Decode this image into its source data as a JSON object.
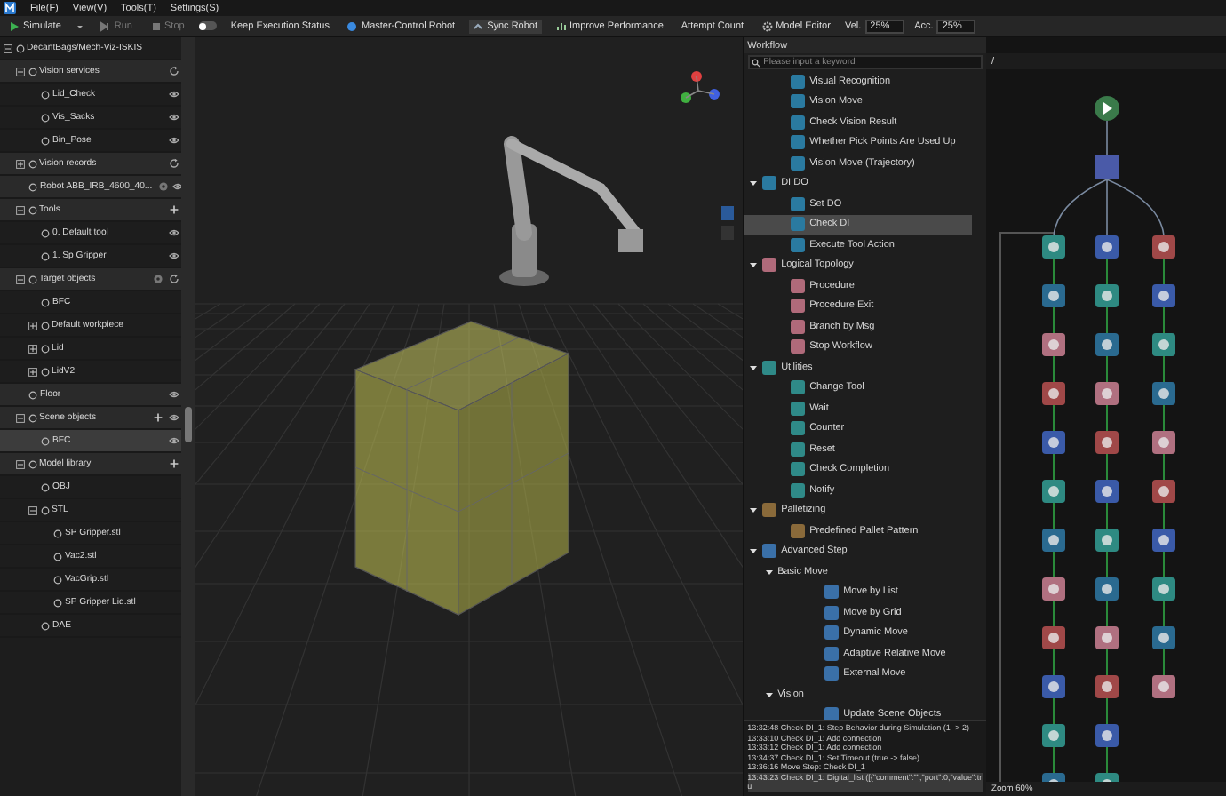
{
  "menu": [
    "File(F)",
    "View(V)",
    "Tools(T)",
    "Settings(S)"
  ],
  "toolbar": [
    {
      "kind": "button",
      "label": "Simulate",
      "disabled": false,
      "active": false
    },
    {
      "kind": "caret"
    },
    {
      "kind": "button",
      "label": "Run",
      "disabled": true,
      "active": false
    },
    {
      "kind": "button",
      "label": "Stop",
      "disabled": true,
      "active": false
    },
    {
      "kind": "toggle",
      "label": "Keep Execution Status",
      "on": false
    },
    {
      "kind": "button",
      "label": "Master-Control Robot",
      "disabled": false,
      "active": false
    },
    {
      "kind": "button",
      "label": "Sync Robot",
      "disabled": false,
      "active": true
    },
    {
      "kind": "button",
      "label": "Improve Performance",
      "disabled": false,
      "active": false
    },
    {
      "kind": "button",
      "label": "Attempt Count",
      "disabled": false,
      "active": false
    },
    {
      "kind": "button",
      "label": "Model Editor",
      "disabled": false,
      "active": false
    },
    {
      "kind": "field",
      "label": "Vel.",
      "value": "25%"
    },
    {
      "kind": "field",
      "label": "Acc.",
      "value": "25%"
    }
  ],
  "tree": {
    "items": [
      {
        "label": "DecantBags/Mech-Viz-ISKIS",
        "expanded": true,
        "selected": false,
        "children": [
          {
            "kind": "refreshable",
            "label": "Vision services",
            "expanded": true,
            "selected": false,
            "children": [
              {
                "label": "Lid_Check",
                "selected": false,
                "visible": true
              },
              {
                "label": "Vis_Sacks",
                "selected": false,
                "visible": true
              },
              {
                "label": "Bin_Pose",
                "selected": false,
                "visible": true
              }
            ]
          },
          {
            "kind": "refreshable",
            "label": "Vision records",
            "expanded": false,
            "selected": false
          },
          {
            "kind": "configurable",
            "label": "Robot ABB_IRB_4600_40...",
            "selected": false,
            "visible": true
          },
          {
            "kind": "addable",
            "label": "Tools",
            "expanded": true,
            "selected": false,
            "children": [
              {
                "label": "0. Default tool",
                "selected": false,
                "visible": true
              },
              {
                "label": "1. Sp Gripper",
                "selected": false,
                "visible": true
              }
            ]
          },
          {
            "kind": "configurable-refreshable",
            "label": "Target objects",
            "expanded": true,
            "selected": false,
            "children": [
              {
                "label": "BFC",
                "selected": false
              },
              {
                "label": "Default workpiece",
                "expanded": false,
                "selected": false
              },
              {
                "label": "Lid",
                "expanded": false,
                "selected": false
              },
              {
                "label": "LidV2",
                "expanded": false,
                "selected": false
              }
            ]
          },
          {
            "label": "Floor",
            "selected": false,
            "visible": true
          },
          {
            "kind": "addable",
            "label": "Scene objects",
            "expanded": true,
            "selected": false,
            "visible": true,
            "children": [
              {
                "label": "BFC",
                "selected": true,
                "visible": true
              }
            ]
          },
          {
            "kind": "addable",
            "label": "Model library",
            "expanded": true,
            "selected": false,
            "children": [
              {
                "label": "OBJ",
                "selected": false
              },
              {
                "label": "STL",
                "expanded": true,
                "selected": false,
                "children": [
                  {
                    "label": "SP Gripper.stl",
                    "selected": false
                  },
                  {
                    "label": "Vac2.stl",
                    "selected": false
                  },
                  {
                    "label": "VacGrip.stl",
                    "selected": false
                  },
                  {
                    "label": "SP Gripper Lid.stl",
                    "selected": false
                  }
                ]
              },
              {
                "label": "DAE",
                "selected": false
              }
            ]
          }
        ]
      }
    ]
  },
  "workflow": {
    "title": "Workflow",
    "search": {
      "placeholder": "Please input a keyword"
    },
    "items": [
      {
        "kind": "step",
        "label": "Visual Recognition",
        "selected": false
      },
      {
        "kind": "step",
        "label": "Vision Move",
        "selected": false
      },
      {
        "kind": "step",
        "label": "Check Vision Result",
        "selected": false
      },
      {
        "kind": "step",
        "label": "Whether Pick Points Are Used Up",
        "selected": false
      },
      {
        "kind": "step",
        "label": "Vision Move (Trajectory)",
        "selected": false
      },
      {
        "kind": "category",
        "label": "DI DO",
        "expanded": true,
        "selected": false,
        "children": [
          {
            "kind": "step",
            "label": "Set DO",
            "selected": false
          },
          {
            "kind": "step",
            "label": "Check DI",
            "selected": true
          },
          {
            "kind": "step",
            "label": "Execute Tool Action",
            "selected": false
          }
        ]
      },
      {
        "kind": "category",
        "label": "Logical Topology",
        "expanded": true,
        "selected": false,
        "children": [
          {
            "kind": "step",
            "label": "Procedure",
            "selected": false
          },
          {
            "kind": "step",
            "label": "Procedure Exit",
            "selected": false
          },
          {
            "kind": "step",
            "label": "Branch by Msg",
            "selected": false
          },
          {
            "kind": "step",
            "label": "Stop Workflow",
            "selected": false
          }
        ]
      },
      {
        "kind": "category",
        "label": "Utilities",
        "expanded": true,
        "selected": false,
        "children": [
          {
            "kind": "step",
            "label": "Change Tool",
            "selected": false
          },
          {
            "kind": "step",
            "label": "Wait",
            "selected": false
          },
          {
            "kind": "step",
            "label": "Counter",
            "selected": false
          },
          {
            "kind": "step",
            "label": "Reset",
            "selected": false
          },
          {
            "kind": "step",
            "label": "Check Completion",
            "selected": false
          },
          {
            "kind": "step",
            "label": "Notify",
            "selected": false
          }
        ]
      },
      {
        "kind": "category",
        "label": "Palletizing",
        "expanded": true,
        "selected": false,
        "children": [
          {
            "kind": "step",
            "label": "Predefined Pallet Pattern",
            "selected": false
          }
        ]
      },
      {
        "kind": "category",
        "label": "Advanced Step",
        "expanded": true,
        "selected": false,
        "children": [
          {
            "kind": "group",
            "label": "Basic Move",
            "expanded": true,
            "selected": false,
            "children": [
              {
                "kind": "step",
                "label": "Move by List",
                "selected": false
              },
              {
                "kind": "step",
                "label": "Move by Grid",
                "selected": false
              },
              {
                "kind": "step",
                "label": "Dynamic Move",
                "selected": false
              },
              {
                "kind": "step",
                "label": "Adaptive Relative Move",
                "selected": false
              },
              {
                "kind": "step",
                "label": "External Move",
                "selected": false
              }
            ]
          },
          {
            "kind": "group",
            "label": "Vision",
            "expanded": true,
            "selected": false,
            "children": [
              {
                "kind": "step",
                "label": "Update Scene Objects",
                "selected": false
              }
            ]
          }
        ]
      }
    ],
    "log": [
      {
        "text": "13:32:48 Check DI_1: Step Behavior during Simulation (1 -> 2)",
        "selected": false
      },
      {
        "text": "13:33:10 Check DI_1: Add connection",
        "selected": false
      },
      {
        "text": "13:33:12 Check DI_1: Add connection",
        "selected": false
      },
      {
        "text": "13:34:37 Check DI_1: Set Timeout (true -> false)",
        "selected": false
      },
      {
        "text": "13:36:16 Move Step: Check DI_1",
        "selected": false
      },
      {
        "text": "13:43:23 Check DI_1: Digital_list ([{\"comment\":\"\",\"port\":0,\"value\":tru",
        "selected": true
      }
    ]
  },
  "canvas": {
    "path": "/",
    "zoom": "Zoom 60%"
  }
}
